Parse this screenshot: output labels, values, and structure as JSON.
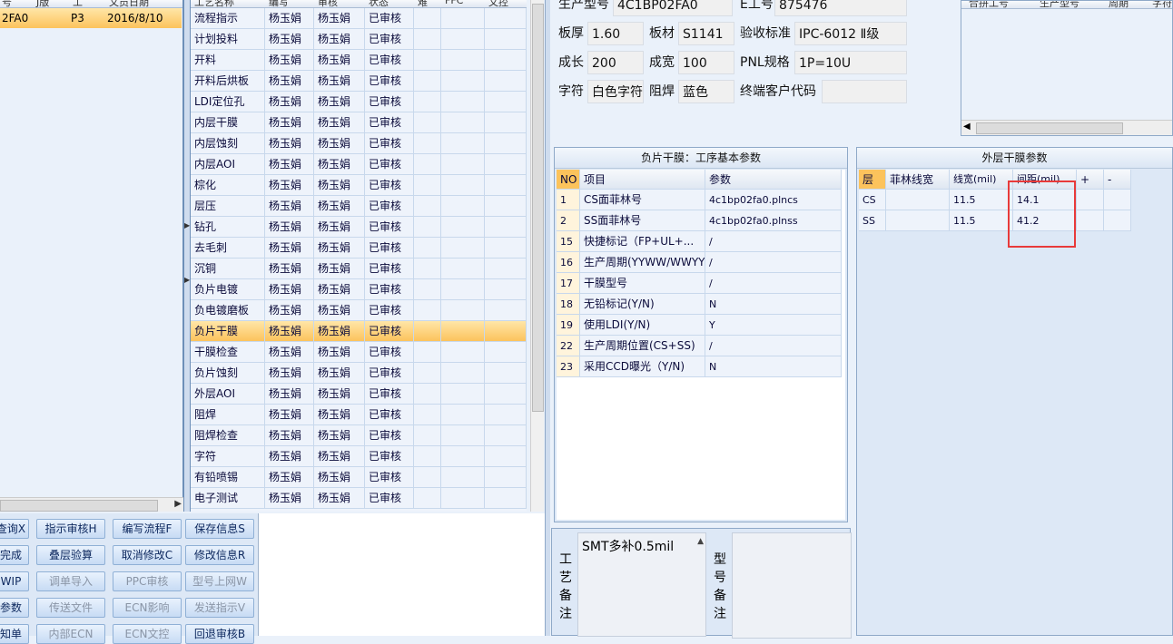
{
  "left_grid": {
    "headers": [
      "号",
      "J版",
      "工",
      "文员日期"
    ],
    "rows": [
      [
        "2FA0",
        "",
        "P3",
        "2016/8/10"
      ]
    ]
  },
  "process_grid": {
    "headers": [
      "工艺名称",
      "编写",
      "审核",
      "状态",
      "难",
      "FFC",
      "文控"
    ],
    "rows": [
      [
        "流程指示",
        "杨玉娟",
        "杨玉娟",
        "已审核"
      ],
      [
        "计划投料",
        "杨玉娟",
        "杨玉娟",
        "已审核"
      ],
      [
        "开料",
        "杨玉娟",
        "杨玉娟",
        "已审核"
      ],
      [
        "开料后烘板",
        "杨玉娟",
        "杨玉娟",
        "已审核"
      ],
      [
        "LDI定位孔",
        "杨玉娟",
        "杨玉娟",
        "已审核"
      ],
      [
        "内层干膜",
        "杨玉娟",
        "杨玉娟",
        "已审核"
      ],
      [
        "内层蚀刻",
        "杨玉娟",
        "杨玉娟",
        "已审核"
      ],
      [
        "内层AOI",
        "杨玉娟",
        "杨玉娟",
        "已审核"
      ],
      [
        "棕化",
        "杨玉娟",
        "杨玉娟",
        "已审核"
      ],
      [
        "层压",
        "杨玉娟",
        "杨玉娟",
        "已审核"
      ],
      [
        "钻孔",
        "杨玉娟",
        "杨玉娟",
        "已审核"
      ],
      [
        "去毛刺",
        "杨玉娟",
        "杨玉娟",
        "已审核"
      ],
      [
        "沉铜",
        "杨玉娟",
        "杨玉娟",
        "已审核"
      ],
      [
        "负片电镀",
        "杨玉娟",
        "杨玉娟",
        "已审核"
      ],
      [
        "负电镀磨板",
        "杨玉娟",
        "杨玉娟",
        "已审核"
      ],
      [
        "负片干膜",
        "杨玉娟",
        "杨玉娟",
        "已审核"
      ],
      [
        "干膜检查",
        "杨玉娟",
        "杨玉娟",
        "已审核"
      ],
      [
        "负片蚀刻",
        "杨玉娟",
        "杨玉娟",
        "已审核"
      ],
      [
        "外层AOI",
        "杨玉娟",
        "杨玉娟",
        "已审核"
      ],
      [
        "阻焊",
        "杨玉娟",
        "杨玉娟",
        "已审核"
      ],
      [
        "阻焊检查",
        "杨玉娟",
        "杨玉娟",
        "已审核"
      ],
      [
        "字符",
        "杨玉娟",
        "杨玉娟",
        "已审核"
      ],
      [
        "有铅喷锡",
        "杨玉娟",
        "杨玉娟",
        "已审核"
      ],
      [
        "电子测试",
        "杨玉娟",
        "杨玉娟",
        "已审核"
      ]
    ],
    "selected_index": 15
  },
  "buttons": [
    [
      "查询X",
      "指示审核H",
      "编写流程F",
      "保存信息S"
    ],
    [
      "完成",
      "叠层验算",
      "取消修改C",
      "修改信息R"
    ],
    [
      "WIP",
      "调单导入",
      "PPC审核",
      "型号上网W"
    ],
    [
      "参数",
      "传送文件",
      "ECN影响",
      "发送指示V"
    ],
    [
      "知单",
      "内部ECN",
      "ECN文控",
      "回退审核B"
    ]
  ],
  "info": {
    "model_label": "生产型号",
    "model_value": "4C1BP02FA0",
    "eno_label": "E工号",
    "eno_value": "875476",
    "thickness_label": "板厚",
    "thickness_value": "1.60",
    "material_label": "板材",
    "material_value": "S1141",
    "standard_label": "验收标准",
    "standard_value": "IPC-6012 Ⅱ级",
    "length_label": "成长",
    "length_value": "200",
    "width_label": "成宽",
    "width_value": "100",
    "pnl_label": "PNL规格",
    "pnl_value": "1P=10U",
    "char_label": "字符",
    "char_value": "白色字符",
    "mask_label": "阻焊",
    "mask_value": "蓝色",
    "customer_label": "终端客户代码",
    "customer_value": ""
  },
  "merge_grid": {
    "headers": [
      "合拼工号",
      "生产型号",
      "周期",
      "字符"
    ]
  },
  "params_panel": {
    "title": "负片干膜：工序基本参数",
    "headers": [
      "NO",
      "项目",
      "参数"
    ],
    "rows": [
      [
        "1",
        "CS面菲林号",
        "4c1bp02fa0.plncs"
      ],
      [
        "2",
        "SS面菲林号",
        "4c1bp02fa0.plnss"
      ],
      [
        "15",
        "快捷标记（FP+UL+...",
        "/"
      ],
      [
        "16",
        "生产周期(YYWW/WWYY)",
        "/"
      ],
      [
        "17",
        "干膜型号",
        "/"
      ],
      [
        "18",
        "无铅标记(Y/N)",
        "N"
      ],
      [
        "19",
        "使用LDI(Y/N)",
        "Y"
      ],
      [
        "22",
        "生产周期位置(CS+SS)",
        "/"
      ],
      [
        "23",
        "采用CCD曝光（Y/N)",
        "N"
      ]
    ]
  },
  "outer_panel": {
    "title": "外层干膜参数",
    "headers": [
      "层",
      "菲林线宽",
      "线宽(mil)",
      "间距(mil)",
      "+",
      "-"
    ],
    "rows": [
      [
        "CS",
        "",
        "11.5",
        "14.1",
        "",
        ""
      ],
      [
        "SS",
        "",
        "11.5",
        "41.2",
        "",
        ""
      ]
    ]
  },
  "remarks": {
    "process_label": "工艺备注",
    "process_text": "SMT多补0.5mil",
    "model_label": "型号备注"
  },
  "colors": {
    "highlight": "#e83a3a",
    "selected_row": "#fcc35c"
  }
}
